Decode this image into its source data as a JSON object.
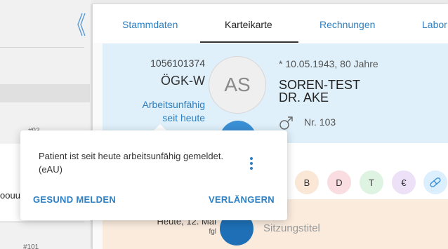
{
  "left_list": {
    "row_number_top": "#93",
    "row_number_bottom": "#101",
    "row_snippet": "oouu",
    "collapse_icon": "chevron-left-icon"
  },
  "tabs": [
    {
      "label": "Stammdaten"
    },
    {
      "label": "Karteikarte",
      "active": true
    },
    {
      "label": "Rechnungen"
    },
    {
      "label": "Labor"
    }
  ],
  "patient": {
    "id": "1056101374",
    "insurer": "ÖGK-W",
    "status_line1": "Arbeitsunfähig",
    "status_line2": "seit heute",
    "initials": "AS",
    "birth": "* 10.05.1943, 80 Jahre",
    "last_name": "SOREN-TEST",
    "first_name": "DR. AKE",
    "gender_icon": "male-icon",
    "number": "Nr. 103"
  },
  "quick_actions": [
    {
      "label": "B",
      "color": "#fbe7d6"
    },
    {
      "label": "D",
      "color": "#f9dde1"
    },
    {
      "label": "T",
      "color": "#dff3e3"
    },
    {
      "label": "€",
      "color": "#ece1f7"
    },
    {
      "label": "",
      "icon": "pill-icon",
      "color": "#dcefff"
    }
  ],
  "session": {
    "date": "Heute, 12. Mai",
    "user": "fgl",
    "title": "Sitzungstitel"
  },
  "popover": {
    "message": "Patient ist seit heute arbeitsunfähig gemeldet. (eAU)",
    "more_icon": "more-vertical-icon",
    "action_left": "GESUND MELDEN",
    "action_right": "VERLÄNGERN"
  },
  "colors": {
    "accent": "#2d7fc1",
    "patient_bg": "#dff0fa",
    "session_bg": "#faebdd"
  }
}
